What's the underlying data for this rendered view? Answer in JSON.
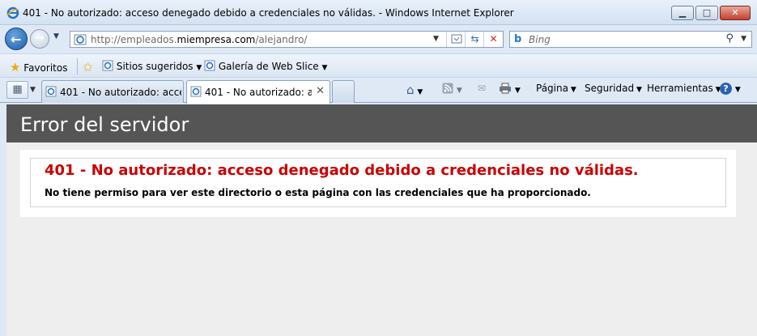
{
  "window": {
    "title": "401 - No autorizado: acceso denegado debido a credenciales no válidas. - Windows Internet Explorer",
    "minimize_glyph": "▁",
    "maximize_glyph": "□",
    "close_glyph": "✕"
  },
  "address_bar": {
    "url_prefix": "http://empleados.",
    "url_host": "miempresa.com",
    "url_suffix": "/alejandro/",
    "search_placeholder": "Bing"
  },
  "favorites_bar": {
    "favorites_label": "Favoritos",
    "suggested_sites_label": "Sitios sugeridos",
    "web_slice_label": "Galería de Web Slice"
  },
  "tabs": [
    {
      "label": "401 - No autorizado: acces...",
      "active": false
    },
    {
      "label": "401 - No autorizado: ac...",
      "active": true
    }
  ],
  "command_bar": {
    "page_label": "Página",
    "security_label": "Seguridad",
    "tools_label": "Herramientas"
  },
  "page": {
    "header_title": "Error del servidor",
    "error_title": "401 - No autorizado: acceso denegado debido a credenciales no válidas.",
    "error_description": "No tiene permiso para ver este directorio o esta página con las credenciales que ha proporcionado."
  },
  "colors": {
    "error_red": "#cc0000",
    "header_bg": "#555555",
    "page_bg": "#eeeeee"
  }
}
